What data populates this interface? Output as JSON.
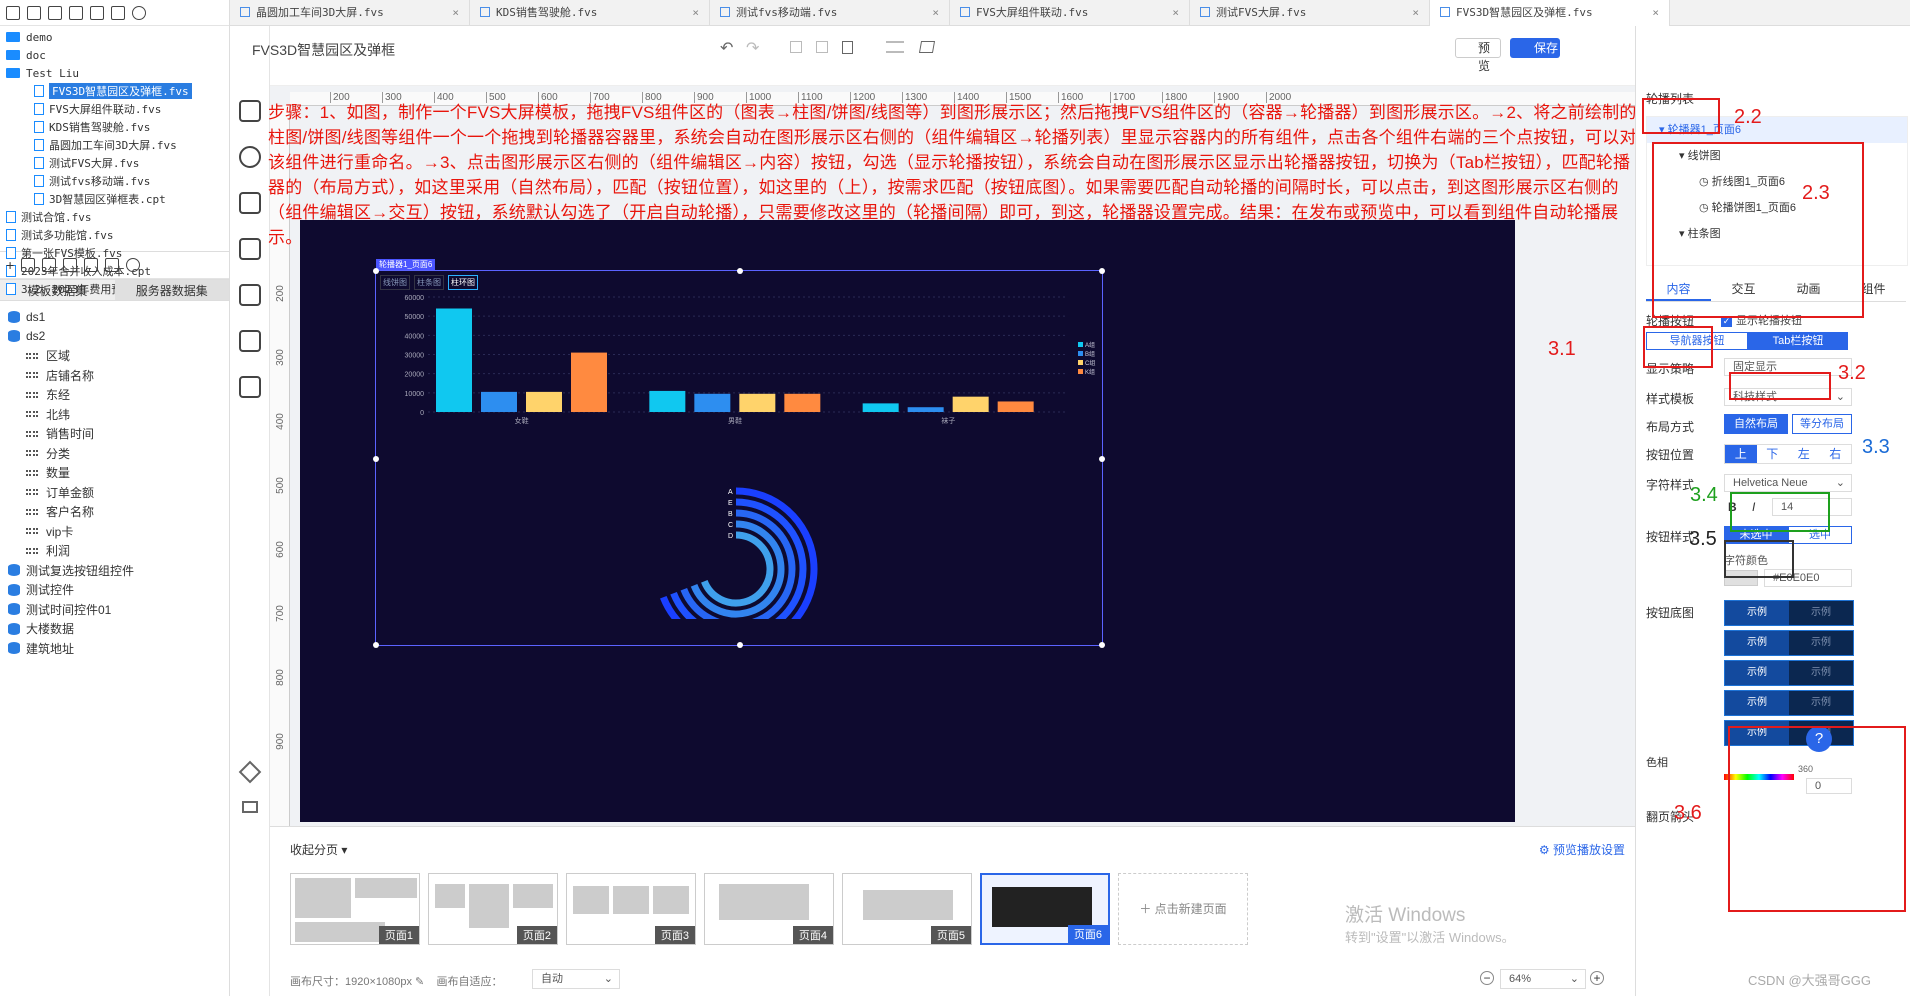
{
  "left": {
    "tree": [
      {
        "type": "folder",
        "label": "demo"
      },
      {
        "type": "folder",
        "label": "doc"
      },
      {
        "type": "folder",
        "label": "Test Liu"
      },
      {
        "type": "file",
        "label": "FVS3D智慧园区及弹框.fvs",
        "selected": true
      },
      {
        "type": "file",
        "label": "FVS大屏组件联动.fvs"
      },
      {
        "type": "file",
        "label": "KDS销售驾驶舱.fvs"
      },
      {
        "type": "file",
        "label": "晶圆加工车间3D大屏.fvs"
      },
      {
        "type": "file",
        "label": "测试FVS大屏.fvs"
      },
      {
        "type": "file",
        "label": "测试fvs移动端.fvs"
      },
      {
        "type": "file",
        "label": "3D智慧园区弹框表.cpt"
      },
      {
        "type": "file",
        "label": "测试合馆.fvs"
      },
      {
        "type": "file",
        "label": "测试多功能馆.fvs"
      },
      {
        "type": "file",
        "label": "第一张FVS模板.fvs"
      },
      {
        "type": "file",
        "label": "2023年合并收入成本.cpt"
      },
      {
        "type": "file",
        "label": "3.2、2023年费用预算与实际分析表"
      }
    ],
    "tabs": [
      "模板数据集",
      "服务器数据集"
    ],
    "datasets": [
      {
        "type": "db",
        "label": "ds1"
      },
      {
        "type": "db",
        "label": "ds2"
      },
      {
        "type": "col",
        "label": "区域"
      },
      {
        "type": "col",
        "label": "店铺名称"
      },
      {
        "type": "col",
        "label": "东经"
      },
      {
        "type": "col",
        "label": "北纬"
      },
      {
        "type": "col",
        "label": "销售时间"
      },
      {
        "type": "col",
        "label": "分类"
      },
      {
        "type": "col",
        "label": "数量"
      },
      {
        "type": "col",
        "label": "订单金额"
      },
      {
        "type": "col",
        "label": "客户名称"
      },
      {
        "type": "col",
        "label": "vip卡"
      },
      {
        "type": "col",
        "label": "利润"
      },
      {
        "type": "db",
        "label": "测试复选按钮组控件"
      },
      {
        "type": "db",
        "label": "测试控件"
      },
      {
        "type": "db",
        "label": "测试时间控件01"
      },
      {
        "type": "db",
        "label": "大楼数据"
      },
      {
        "type": "db",
        "label": "建筑地址"
      }
    ]
  },
  "tabs": [
    "晶圆加工车间3D大屏.fvs",
    "KDS销售驾驶舱.fvs",
    "测试fvs移动端.fvs",
    "FVS大屏组件联动.fvs",
    "测试FVS大屏.fvs",
    "FVS3D智慧园区及弹框.fvs"
  ],
  "header": {
    "title": "FVS3D智慧园区及弹框",
    "preview": "预览",
    "save": "保存"
  },
  "ruler_x": [
    "200",
    "300",
    "400",
    "500",
    "600",
    "700",
    "800",
    "900",
    "1000",
    "1100",
    "1200",
    "1300",
    "1400",
    "1500",
    "1600",
    "1700",
    "1800",
    "1900",
    "2000"
  ],
  "ruler_y": [
    "200",
    "300",
    "400",
    "500",
    "600",
    "700",
    "800",
    "900"
  ],
  "instructions": "步骤：1、如图，制作一个FVS大屏模板，拖拽FVS组件区的（图表→柱图/饼图/线图等）到图形展示区；然后拖拽FVS组件区的（容器→轮播器）到图形展示区。→2、将之前绘制的柱图/饼图/线图等组件一个一个拖拽到轮播器容器里，系统会自动在图形展示区右侧的（组件编辑区→轮播列表）里显示容器内的所有组件，点击各个组件右端的三个点按钮，可以对该组件进行重命名。→3、点击图形展示区右侧的（组件编辑区→内容）按钮，勾选（显示轮播按钮），系统会自动在图形展示区显示出轮播器按钮，切换为（Tab栏按钮），匹配轮播器的（布局方式），如这里采用（自然布局），匹配（按钮位置），如这里的（上），按需求匹配（按钮底图）。如果需要匹配自动轮播的间隔时长，可以点击，到这图形展示区右侧的（组件编辑区→交互）按钮，系统默认勾选了（开启自动轮播），只需要修改这里的（轮播间隔）即可，到这，轮播器设置完成。结果：在发布或预览中，可以看到组件自动轮播展示。",
  "carousel": {
    "tag": "轮播器1_页面6",
    "tabs": [
      "线饼图",
      "柱条图",
      "柱环图"
    ]
  },
  "chart_data": [
    {
      "type": "bar",
      "categories": [
        "女鞋",
        "男鞋",
        "袜子"
      ],
      "ylim": [
        0,
        60000
      ],
      "yticks": [
        "60000",
        "50000",
        "40000",
        "30000",
        "20000",
        "10000",
        "0"
      ],
      "series": [
        {
          "name": "A组",
          "color": "#10c8f0",
          "values": [
            54000,
            11000,
            4500
          ]
        },
        {
          "name": "B组",
          "color": "#2d8ef0",
          "values": [
            10500,
            9500,
            2500
          ]
        },
        {
          "name": "C组",
          "color": "#ffd36b",
          "values": [
            10500,
            9500,
            8000
          ]
        },
        {
          "name": "K组",
          "color": "#ff8a40",
          "values": [
            31000,
            9500,
            5500
          ]
        }
      ],
      "legend": "right"
    },
    {
      "type": "radial-bar",
      "categories": [
        "A",
        "E",
        "B",
        "C",
        "D"
      ]
    }
  ],
  "bottom": {
    "collapse": "收起分页",
    "settings": "预览播放设置",
    "pages": [
      "页面1",
      "页面2",
      "页面3",
      "页面4",
      "页面5",
      "页面6"
    ],
    "new_page": "点击新建页面",
    "canvas_size_label": "画布尺寸：",
    "canvas_size": "1920×1080px",
    "adapt_label": "画布自适应：",
    "adapt_value": "自动",
    "zoom": "64%"
  },
  "right": {
    "carousel_list_label": "轮播列表",
    "list": [
      {
        "label": "轮播器1_页面6",
        "level": 0,
        "selected": true
      },
      {
        "label": "线饼图",
        "level": 1
      },
      {
        "label": "折线图1_页面6",
        "level": 2
      },
      {
        "label": "轮播饼图1_页面6",
        "level": 2
      },
      {
        "label": "柱条图",
        "level": 1
      }
    ],
    "tabs": [
      "内容",
      "交互",
      "动画",
      "组件"
    ],
    "carousel_btn_label": "轮播按钮",
    "show_btn": "显示轮播按钮",
    "btn_types": [
      "导航器按钮",
      "Tab栏按钮"
    ],
    "display_label": "显示策略",
    "display_value": "固定显示",
    "style_label": "样式模板",
    "style_value": "科技样式",
    "layout_label": "布局方式",
    "layout_options": [
      "自然布局",
      "等分布局"
    ],
    "pos_label": "按钮位置",
    "pos_options": [
      "上",
      "下",
      "左",
      "右"
    ],
    "font_label": "字符样式",
    "font_value": "Helvetica Neue",
    "font_size": "14",
    "btnstyle_label": "按钮样式",
    "btnstyle_options": [
      "未选中",
      "选中"
    ],
    "color_label": "字符颜色",
    "color_value": "#E0E0E0",
    "bg_label": "按钮底图",
    "sample": "示例",
    "sample_dim": "示例",
    "hue_label": "色相",
    "hue_max": "360",
    "hue_val": "0",
    "arrow_label": "翻页箭头"
  },
  "annotations": {
    "a22": "2.2",
    "a23": "2.3",
    "a31": "3.1",
    "a32": "3.2",
    "a33": "3.3",
    "a34": "3.4",
    "a35": "3.5",
    "a36": "3.6"
  },
  "watermark": {
    "line1": "激活 Windows",
    "line2": "转到\"设置\"以激活 Windows。",
    "csdn": "CSDN @大强哥GGG"
  }
}
